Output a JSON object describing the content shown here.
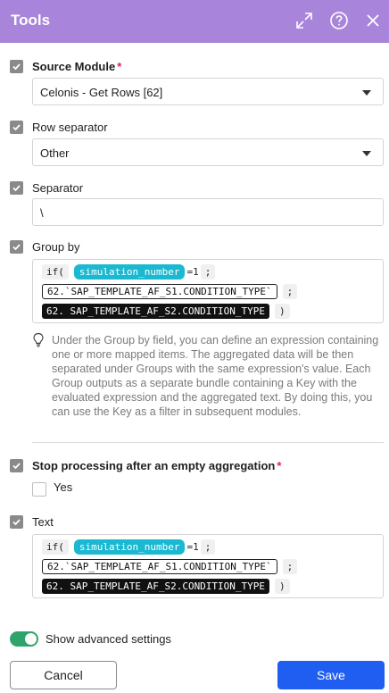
{
  "header": {
    "title": "Tools",
    "icons": [
      "expand-icon",
      "help-icon",
      "close-icon"
    ]
  },
  "source_module": {
    "label": "Source Module",
    "required_mark": "*",
    "value": "Celonis - Get Rows [62]"
  },
  "row_separator": {
    "label": "Row separator",
    "value": "Other"
  },
  "separator": {
    "label": "Separator",
    "value": "\\"
  },
  "group_by": {
    "label": "Group by",
    "expr": {
      "fn": "if(",
      "var": "simulation_number",
      "eq": "=1",
      "semi1": ";",
      "field1": "62.`SAP_TEMPLATE_AF_S1.CONDITION_TYPE`",
      "semi2": ";",
      "field2": "62. SAP_TEMPLATE_AF_S2.CONDITION_TYPE",
      "close": ")"
    },
    "help": "Under the Group by field, you can define an expression containing one or more mapped items. The aggregated data will be then separated under Groups with the same expression's value. Each Group outputs as a separate bundle containing a Key with the evaluated expression and the aggregated text. By doing this, you can use the Key as a filter in subsequent modules."
  },
  "stop_processing": {
    "label": "Stop processing after an empty aggregation",
    "required_mark": "*",
    "option_label": "Yes",
    "checked": false
  },
  "text_field": {
    "label": "Text",
    "expr": {
      "fn": "if(",
      "var": "simulation_number",
      "eq": "=1",
      "semi1": ";",
      "field1": "62.`SAP_TEMPLATE_AF_S1.CONDITION_TYPE`",
      "semi2": ";",
      "field2": "62. SAP_TEMPLATE_AF_S2.CONDITION_TYPE",
      "close": ")"
    }
  },
  "advanced": {
    "label": "Show advanced settings",
    "enabled": true
  },
  "footer": {
    "cancel_label": "Cancel",
    "save_label": "Save"
  },
  "colors": {
    "header": "#a885db",
    "variable_pill": "#1ab8d1",
    "toggle_on": "#2fa46a",
    "save_button": "#1f5ef0",
    "required": "#e0244f"
  }
}
